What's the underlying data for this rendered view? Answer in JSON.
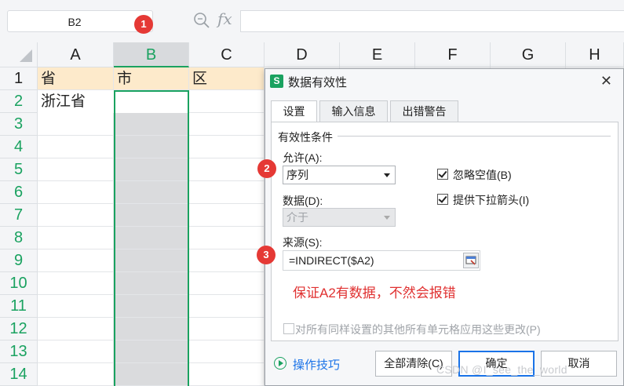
{
  "formula_bar": {
    "cell_reference": "B2",
    "fx_label": "fx",
    "formula_value": ""
  },
  "badges": [
    "1",
    "2",
    "3"
  ],
  "columns": [
    "A",
    "B",
    "C",
    "D",
    "E",
    "F",
    "G",
    "H"
  ],
  "rows": [
    "1",
    "2",
    "3",
    "4",
    "5",
    "6",
    "7",
    "8",
    "9",
    "10",
    "11",
    "12",
    "13",
    "14"
  ],
  "cells": {
    "A1": "省",
    "B1": "市",
    "C1": "区",
    "A2": "浙江省"
  },
  "dialog": {
    "title": "数据有效性",
    "tabs": [
      "设置",
      "输入信息",
      "出错警告"
    ],
    "group_title": "有效性条件",
    "allow_label": "允许(A):",
    "allow_value": "序列",
    "data_label": "数据(D):",
    "data_value": "介于",
    "ignore_blank_label": "忽略空值(B)",
    "ignore_blank_checked": true,
    "dropdown_label": "提供下拉箭头(I)",
    "dropdown_checked": true,
    "source_label": "来源(S):",
    "source_value": "=INDIRECT($A2)",
    "annotation": "保证A2有数据，不然会报错",
    "apply_all_label": "对所有同样设置的其他所有单元格应用这些更改(P)",
    "tips_link": "操作技巧",
    "clear_all_button": "全部清除(C)",
    "ok_button": "确定",
    "cancel_button": "取消"
  },
  "watermark": "CSDN @I_see_the_world",
  "colors": {
    "accent_green": "#1aa260",
    "header_row_fill": "#fdeacb",
    "annotation_red": "#e03131",
    "badge_red": "#e53935"
  }
}
